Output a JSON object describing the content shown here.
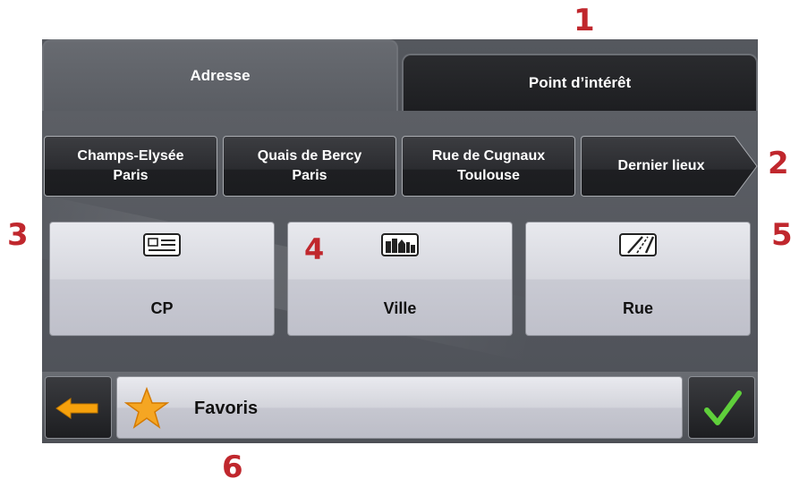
{
  "tabs": [
    {
      "label": "Adresse",
      "active": true
    },
    {
      "label": "Point d’intérêt",
      "active": false
    }
  ],
  "recent_locations": [
    {
      "line1": "Champs-Elysée",
      "line2": "Paris"
    },
    {
      "line1": "Quais de Bercy",
      "line2": "Paris"
    },
    {
      "line1": "Rue de Cugnaux",
      "line2": "Toulouse"
    }
  ],
  "last_places_label": "Dernier lieux",
  "search_buttons": [
    {
      "label": "CP",
      "icon": "postcode-card-icon"
    },
    {
      "label": "Ville",
      "icon": "city-buildings-icon"
    },
    {
      "label": "Rue",
      "icon": "road-icon"
    }
  ],
  "bottom": {
    "back_icon": "back-arrow-icon",
    "favorites_label": "Favoris",
    "favorites_icon": "star-icon",
    "confirm_icon": "checkmark-icon"
  },
  "callouts": [
    "1",
    "2",
    "3",
    "4",
    "5",
    "6"
  ],
  "colors": {
    "callout": "#c0272d",
    "star": "#f5a623",
    "back_arrow": "#f6a10c",
    "check": "#5fcf3b"
  }
}
